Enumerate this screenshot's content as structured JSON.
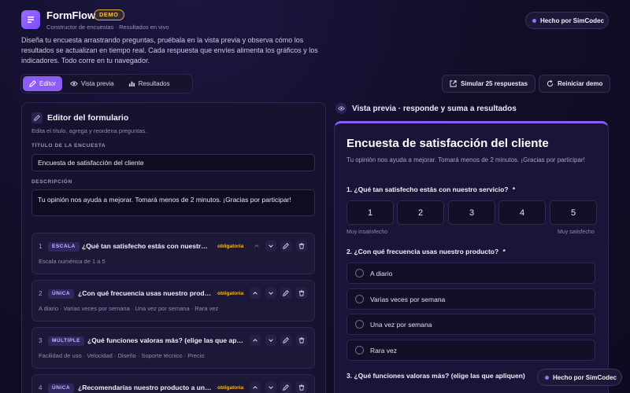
{
  "app": {
    "title": "FormFlow",
    "badge": "DEMO",
    "subtitle": "Constructor de encuestas · Resultados en vivo",
    "intro": "Diseña tu encuesta arrastrando preguntas, pruébala en la vista previa y observa cómo los resultados se actualizan en tiempo real. Cada respuesta que envíes alimenta los gráficos y los indicadores. Todo corre en tu navegador.",
    "made_by": "Hecho por SimCodec"
  },
  "tabs": [
    {
      "label": "Editor",
      "icon": "pencil-icon",
      "active": true
    },
    {
      "label": "Vista previa",
      "icon": "eye-icon",
      "active": false
    },
    {
      "label": "Resultados",
      "icon": "bar-chart-icon",
      "active": false
    }
  ],
  "actions": {
    "simulate": "Simular 25 respuestas",
    "reset": "Reiniciar demo"
  },
  "editor": {
    "title": "Editor del formulario",
    "subtitle": "Edita el título, agrega y reordena preguntas.",
    "title_label": "TÍTULO DE LA ENCUESTA",
    "title_value": "Encuesta de satisfacción del cliente",
    "desc_label": "DESCRIPCIÓN",
    "desc_value": "Tu opinión nos ayuda a mejorar. Tomará menos de 2 minutos. ¡Gracias por participar!",
    "questions": [
      {
        "num": "1",
        "type": "ESCALA",
        "text": "¿Qué tan satisfecho estás con nuestr…",
        "required": "obligatoria",
        "desc": "Escala numérica de 1 a 5"
      },
      {
        "num": "2",
        "type": "ÚNICA",
        "text": "¿Con qué frecuencia usas nuestro prod…",
        "required": "obligatoria",
        "desc": "A diario · Varias veces por semana · Una vez por semana · Rara vez"
      },
      {
        "num": "3",
        "type": "MÚLTIPLE",
        "text": "¿Qué funciones valoras más? (elige las que ap…",
        "required": "",
        "desc": "Facilidad de uso · Velocidad · Diseño · Soporte técnico · Precio"
      },
      {
        "num": "4",
        "type": "ÚNICA",
        "text": "¿Recomendarías nuestro producto a un…",
        "required": "obligatoria",
        "desc": ""
      }
    ]
  },
  "preview": {
    "header": "Vista previa · responde y suma a resultados",
    "title": "Encuesta de satisfacción del cliente",
    "subtitle": "Tu opinión nos ayuda a mejorar. Tomará menos de 2 minutos. ¡Gracias por participar!",
    "q1": "1. ¿Qué tan satisfecho estás con nuestro servicio?",
    "q1_req": "*",
    "scale": [
      "1",
      "2",
      "3",
      "4",
      "5"
    ],
    "scale_low": "Muy insatisfecho",
    "scale_high": "Muy satisfecho",
    "q2": "2. ¿Con qué frecuencia usas nuestro producto?",
    "q2_req": "*",
    "options": [
      "A diario",
      "Varias veces por semana",
      "Una vez por semana",
      "Rara vez"
    ],
    "q3": "3. ¿Qué funciones valoras más? (elige las que apliquen)"
  },
  "colors": {
    "accent": "#8b5cf6",
    "required": "#f0b93a",
    "badge": "#f0c24a"
  }
}
